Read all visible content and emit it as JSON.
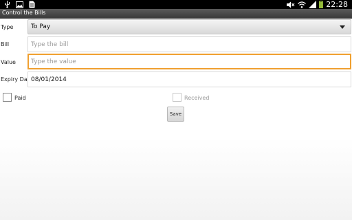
{
  "statusbar": {
    "left_icons": [
      "usb-icon",
      "image-icon",
      "document-icon"
    ],
    "right_icons": [
      "mute-icon",
      "wifi-icon",
      "battery-icon",
      "signal-icon"
    ],
    "time": "22:28"
  },
  "app": {
    "title": "Control the Bills"
  },
  "form": {
    "type_label": "Type",
    "type_value": "To Pay",
    "bill_label": "Bill",
    "bill_placeholder": "Type the bill",
    "value_label": "Value",
    "value_placeholder": "Type the value",
    "expiry_label": "Expiry Date",
    "expiry_value": "08/01/2014",
    "paid_label": "Paid",
    "received_label": "Received",
    "save_label": "Save"
  },
  "colors": {
    "focus_accent": "#f0a030",
    "titlebar": "#4a4a4a"
  }
}
